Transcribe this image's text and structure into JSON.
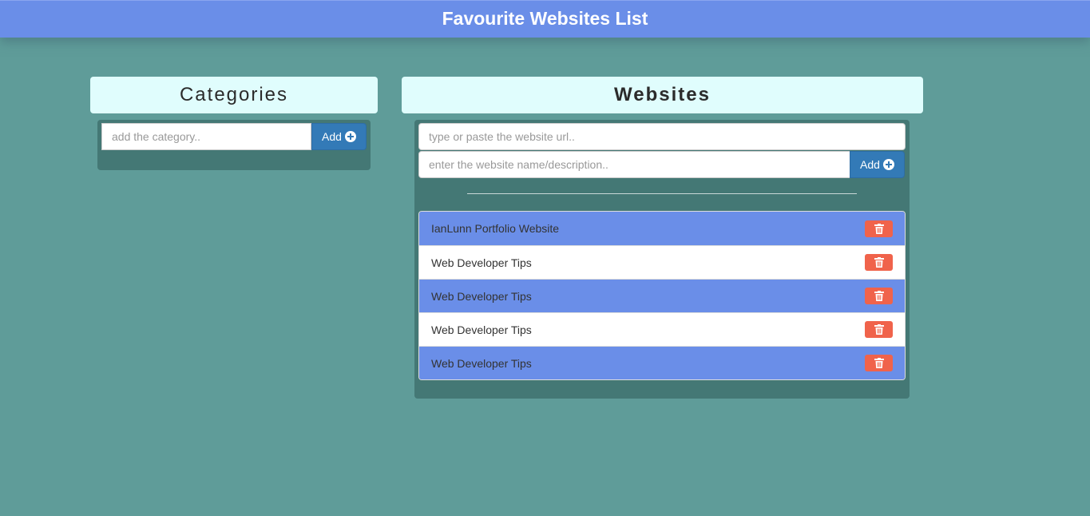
{
  "header": {
    "title": "Favourite Websites List"
  },
  "categories": {
    "title": "Categories",
    "input_placeholder": "add the category..",
    "add_label": "Add"
  },
  "websites": {
    "title": "Websites",
    "url_placeholder": "type or paste the website url..",
    "name_placeholder": "enter the website name/description..",
    "add_label": "Add",
    "items": [
      {
        "label": "IanLunn Portfolio Website"
      },
      {
        "label": "Web Developer Tips"
      },
      {
        "label": "Web Developer Tips"
      },
      {
        "label": "Web Developer Tips"
      },
      {
        "label": "Web Developer Tips"
      }
    ]
  },
  "icons": {
    "add": "plus-circle-icon",
    "delete": "trash-icon"
  },
  "colors": {
    "background": "#5f9c99",
    "header": "#6a8ee8",
    "panel_title_bg": "#e0fdfd",
    "panel_bg": "#447875",
    "add_button": "#337ab7",
    "delete_button": "#f0634b",
    "row_highlight": "#6a8ee8"
  }
}
